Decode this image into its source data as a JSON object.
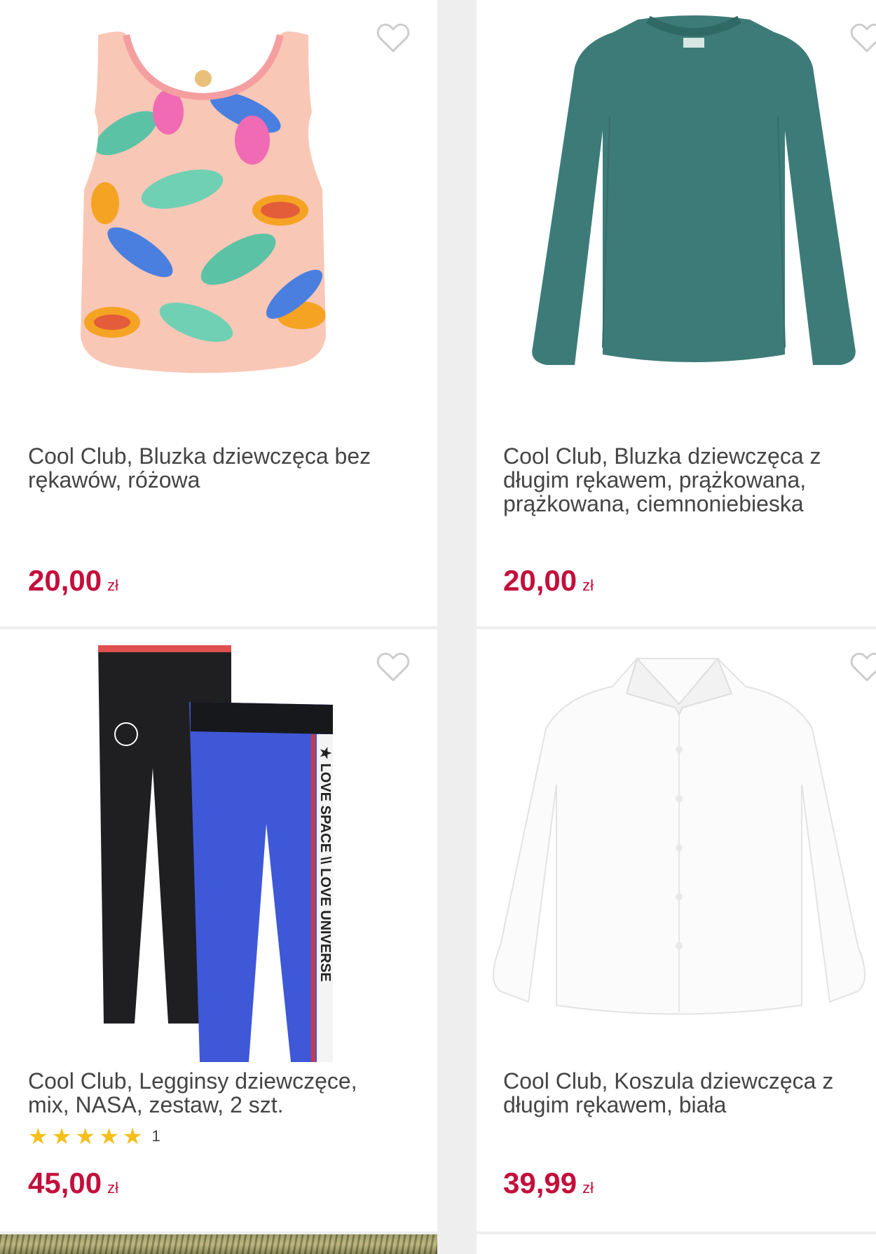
{
  "products": [
    {
      "title": "Cool Club, Bluzka dziewczęca bez\nrękawów, różowa",
      "price": "20,00",
      "currency": "zł",
      "image": "pink-tropical-print-tank-top",
      "wishlist_icon": "heart-outline-icon"
    },
    {
      "title": "Cool Club, Bluzka dziewczęca z\ndługim rękawem, prążkowana,\nprążkowana, ciemnoniebieska",
      "price": "20,00",
      "currency": "zł",
      "image": "teal-ribbed-long-sleeve-top",
      "wishlist_icon": "heart-outline-icon"
    },
    {
      "title": "Cool Club, Legginsy dziewczęce,\nmix, NASA, zestaw, 2 szt.",
      "price": "45,00",
      "currency": "zł",
      "image": "black-and-blue-leggings-set",
      "wishlist_icon": "heart-outline-icon",
      "rating": {
        "stars": 5,
        "count": "1"
      },
      "print_text": "★ LOVE SPACE \\\\ LOVE UNIVERSE"
    },
    {
      "title": "Cool Club, Koszula dziewczęca z\ndługim rękawem, biała",
      "price": "39,99",
      "currency": "zł",
      "image": "white-long-sleeve-shirt",
      "wishlist_icon": "heart-outline-icon"
    }
  ],
  "colors": {
    "price": "#c30f3c",
    "star": "#f6bf1a",
    "title": "#444444",
    "background": "#eeeeee"
  }
}
